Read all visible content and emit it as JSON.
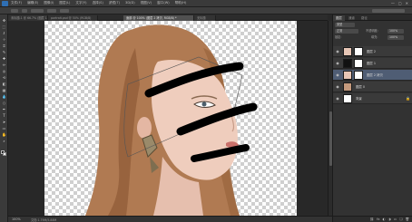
{
  "menubar": {
    "app_icon": "photoshop-logo",
    "menu_items": [
      "文件(F)",
      "编辑(E)",
      "图像(I)",
      "图层(L)",
      "文字(Y)",
      "选择(S)",
      "滤镜(T)",
      "3D(D)",
      "视图(V)",
      "窗口(W)",
      "帮助(H)"
    ],
    "window_controls": [
      "—",
      "▢",
      "✕"
    ]
  },
  "tabs": [
    {
      "label": "未标题-1 @ 66.7% (图层 1, RGB/8)",
      "active": false
    },
    {
      "label": "portrait.psd @ 50% (RGB/8)",
      "active": false
    },
    {
      "label": "面部 @ 100% (图层 2 拷贝, RGB/8) *",
      "active": true
    },
    {
      "label": "无标题",
      "active": false
    }
  ],
  "status": {
    "zoom": "100%",
    "doc_size": "文档:1.79M/5.88M"
  },
  "panel_tabs": [
    "图层",
    "通道",
    "路径"
  ],
  "layer_controls": {
    "kind": "类型",
    "blend_mode": "正常",
    "opacity_label": "不透明度:",
    "opacity": "100%",
    "lock_label": "锁定:",
    "fill_label": "填充:",
    "fill": "100%"
  },
  "layers": [
    {
      "name": "图层 2",
      "visible": true,
      "selected": false,
      "has_mask": true,
      "thumb_color": "#e7c6b6"
    },
    {
      "name": "图层 1",
      "visible": true,
      "selected": false,
      "has_mask": true,
      "thumb_color": "#111111"
    },
    {
      "name": "图层 2 拷贝",
      "visible": true,
      "selected": true,
      "has_mask": true,
      "thumb_color": "#e7c6b6"
    },
    {
      "name": "图层 0",
      "visible": true,
      "selected": false,
      "has_mask": false,
      "thumb_color": "#c59a7d"
    },
    {
      "name": "背景",
      "visible": true,
      "selected": false,
      "has_mask": false,
      "thumb_color": "#ffffff",
      "locked": true
    }
  ],
  "panel_bottom_icons": [
    "link-icon",
    "fx-icon",
    "mask-icon",
    "adjustment-icon",
    "group-icon",
    "new-layer-icon",
    "trash-icon"
  ],
  "tools": [
    "move-icon",
    "marquee-icon",
    "lasso-icon",
    "wand-icon",
    "crop-icon",
    "eyedropper-icon",
    "heal-icon",
    "brush-icon",
    "stamp-icon",
    "history-brush-icon",
    "eraser-icon",
    "gradient-icon",
    "blur-icon",
    "dodge-icon",
    "pen-icon",
    "type-icon",
    "path-select-icon",
    "shape-icon",
    "hand-icon",
    "zoom-icon"
  ],
  "colors": {
    "accent": "#4f5d74",
    "brand": "#2f6fb4"
  }
}
